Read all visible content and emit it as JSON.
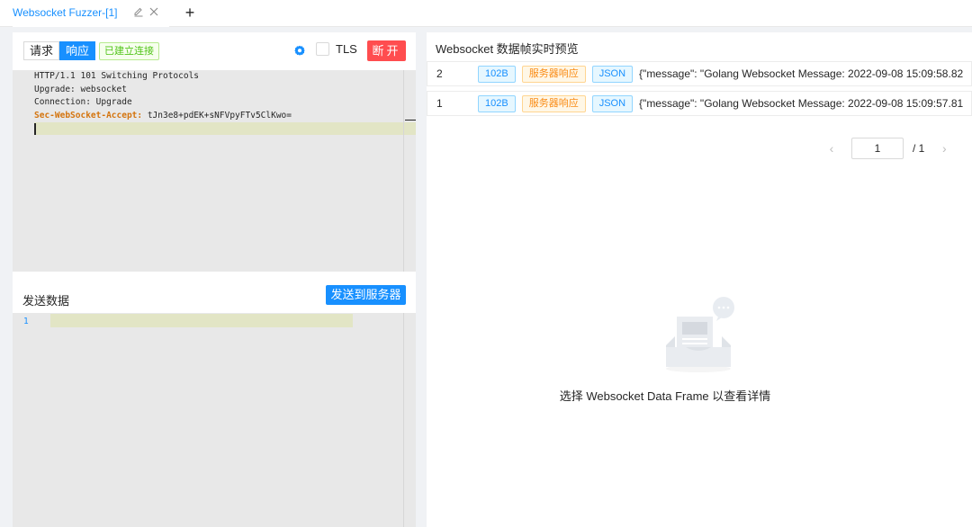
{
  "tabbar": {
    "tab_title": "Websocket Fuzzer-[1]",
    "edit_icon": "edit-icon",
    "close_icon": "close-icon",
    "add_symbol": "+"
  },
  "request_panel": {
    "request_label": "请求",
    "response_label": "响应",
    "selected": "响应",
    "status_tag": "已建立连接",
    "tls_label": "TLS",
    "tls_checked": false,
    "disconnect_label": "断开",
    "response_lines": [
      {
        "text": "HTTP/1.1 101 Switching Protocols"
      },
      {
        "text": "Upgrade: websocket"
      },
      {
        "text": "Connection: Upgrade"
      }
    ],
    "accept_header": {
      "key": "Sec-WebSocket-Accept:",
      "value": " tJn3e8+pdEK+sNFVpyFTv5ClKwo="
    }
  },
  "send_panel": {
    "title": "发送数据",
    "send_button": "发送到服务器",
    "line_number": "1"
  },
  "frames_panel": {
    "title": "Websocket 数据帧实时预览",
    "rows": [
      {
        "id": "2",
        "size": "102B",
        "direction": "服务器响应",
        "type": "JSON",
        "message": "{\"message\": \"Golang Websocket Message: 2022-09-08 15:09:58.82"
      },
      {
        "id": "1",
        "size": "102B",
        "direction": "服务器响应",
        "type": "JSON",
        "message": "{\"message\": \"Golang Websocket Message: 2022-09-08 15:09:57.81"
      }
    ],
    "pagination": {
      "current": "1",
      "total": "/ 1"
    },
    "empty_text": "选择 Websocket Data Frame 以查看详情"
  },
  "colors": {
    "primary": "#1890ff",
    "danger": "#ff4d4f",
    "success": "#52c41a",
    "warning": "#fa8c16"
  }
}
